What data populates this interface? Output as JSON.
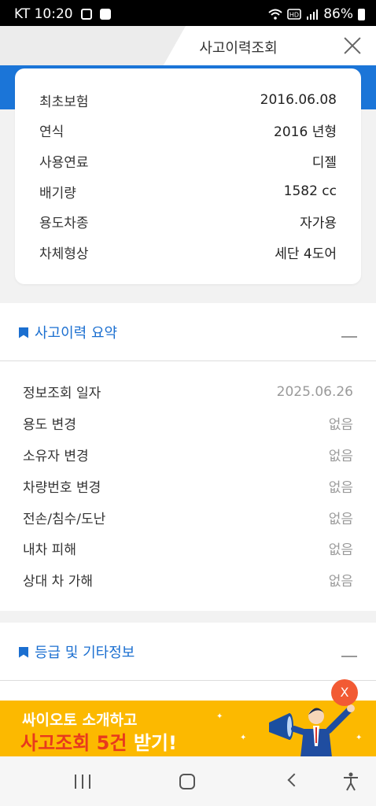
{
  "status_bar": {
    "carrier_time": "KT 10:20",
    "battery": "86%",
    "icons": [
      "voicemail-icon",
      "check-icon",
      "wifi-icon",
      "hd-icon",
      "signal-icon",
      "battery-icon"
    ]
  },
  "header": {
    "title": "사고이력조회",
    "close_icon": "close-icon"
  },
  "colors": {
    "accent_blue": "#1b75d8",
    "banner_yellow": "#fcb900",
    "banner_highlight": "#e8391d",
    "ad_close": "#f25a34"
  },
  "vehicle_info": {
    "rows": [
      {
        "label": "최초보험",
        "value": "2016.06.08"
      },
      {
        "label": "연식",
        "value": "2016 년형"
      },
      {
        "label": "사용연료",
        "value": "디젤"
      },
      {
        "label": "배기량",
        "value": "1582 cc"
      },
      {
        "label": "용도차종",
        "value": "자가용"
      },
      {
        "label": "차체형상",
        "value": "세단 4도어"
      }
    ]
  },
  "accident_summary": {
    "title": "사고이력 요약",
    "rows": [
      {
        "label": "정보조회 일자",
        "value": "2025.06.26"
      },
      {
        "label": "용도 변경",
        "value": "없음"
      },
      {
        "label": "소유자 변경",
        "value": "없음"
      },
      {
        "label": "차량번호 변경",
        "value": "없음"
      },
      {
        "label": "전손/침수/도난",
        "value": "없음"
      },
      {
        "label": "내차 피해",
        "value": "없음"
      },
      {
        "label": "상대 차 가해",
        "value": "없음"
      }
    ]
  },
  "grade_section": {
    "title": "등급 및 기타정보"
  },
  "ad_banner": {
    "line1": "싸이오토 소개하고",
    "line2_highlight": "사고조회 5건",
    "line2_rest": " 받기!",
    "close_label": "X"
  },
  "nav_bar": {
    "icons": [
      "recent-apps-icon",
      "home-icon",
      "back-icon",
      "accessibility-icon"
    ]
  }
}
